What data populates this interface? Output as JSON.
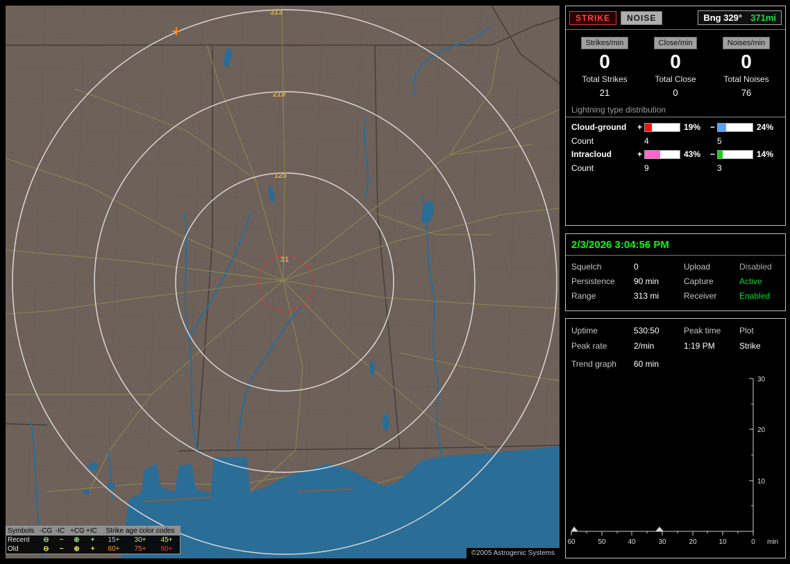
{
  "map": {
    "ring_labels": [
      "313",
      "219",
      "125",
      "31"
    ],
    "ring_label_color": "#d9b25f",
    "copyright": "©2005 Astrogenic Systems",
    "legend": {
      "symbols_header": "Symbols",
      "symbol_types": [
        "-CG",
        "-IC",
        "+CG",
        "+IC"
      ],
      "age_header": "Strike age color codes",
      "symbols": [
        "⊖",
        "−",
        "⊕",
        "+"
      ],
      "rows": [
        {
          "label": "Recent",
          "symbol_color": "#8ee08e",
          "ages": [
            {
              "text": "15+",
              "color": "#b9c8f2"
            },
            {
              "text": "30+",
              "color": "#dede9a"
            },
            {
              "text": "45+",
              "color": "#f0f060"
            }
          ]
        },
        {
          "label": "Old",
          "symbol_color": "#e8e860",
          "ages": [
            {
              "text": "60+",
              "color": "#ffa030"
            },
            {
              "text": "75+",
              "color": "#ff7030"
            },
            {
              "text": "90+",
              "color": "#ff3030"
            }
          ]
        }
      ]
    }
  },
  "sidebar": {
    "buttons": {
      "strike": "STRIKE",
      "noise": "NOISE"
    },
    "bearing": {
      "label": "Bng 329°",
      "range": "371mi",
      "range_color": "#00e645"
    },
    "counters": [
      {
        "label": "Strikes/min",
        "value": "0"
      },
      {
        "label": "Close/min",
        "value": "0"
      },
      {
        "label": "Noises/min",
        "value": "0"
      }
    ],
    "totals": [
      {
        "label": "Total Strikes",
        "value": "21"
      },
      {
        "label": "Total Close",
        "value": "0"
      },
      {
        "label": "Total Noises",
        "value": "76"
      }
    ],
    "distribution": {
      "title": "Lightning type distribution",
      "rows": [
        {
          "label": "Cloud-ground",
          "plus_sign": "+",
          "minus_sign": "−",
          "plus_pct": "19%",
          "plus_color": "#ff1010",
          "minus_pct": "24%",
          "minus_color": "#5aa0ff",
          "count_label": "Count",
          "plus_count": "4",
          "minus_count": "5"
        },
        {
          "label": "Intracloud",
          "plus_sign": "+",
          "minus_sign": "−",
          "plus_pct": "43%",
          "plus_color": "#ff66cc",
          "minus_pct": "14%",
          "minus_color": "#18d018",
          "count_label": "Count",
          "plus_count": "9",
          "minus_count": "3"
        }
      ]
    },
    "status": {
      "datetime": "2/3/2026 3:04:56 PM",
      "rows": [
        {
          "l1": "Squelch",
          "v1": "0",
          "l2": "Upload",
          "v2": "Disabled",
          "v2_color": "#aaaaaa"
        },
        {
          "l1": "Persistence",
          "v1": "90 min",
          "l2": "Capture",
          "v2": "Active",
          "v2_color": "#00dd33"
        },
        {
          "l1": "Range",
          "v1": "313 mi",
          "l2": "Receiver",
          "v2": "Enabled",
          "v2_color": "#00dd33"
        }
      ]
    },
    "info": {
      "uptime_label": "Uptime",
      "uptime": "530:50",
      "peak_time_label": "Peak time",
      "plot_label": "Plot",
      "peak_rate_label": "Peak rate",
      "peak_rate": "2/min",
      "peak_time": "1:19 PM",
      "plot_value": "Strike",
      "trend_label": "Trend graph",
      "trend_window": "60 min"
    }
  },
  "chart_data": {
    "type": "line",
    "title": "Trend graph",
    "window_label": "60 min",
    "x_ticks": [
      "60",
      "50",
      "40",
      "30",
      "20",
      "10",
      "0"
    ],
    "x_unit": "min",
    "y_ticks": [
      "30",
      "20",
      "10"
    ],
    "ylim": [
      0,
      30
    ],
    "series": [
      {
        "name": "Strike",
        "points": [
          {
            "minutes_ago": 59,
            "value": 1
          },
          {
            "minutes_ago": 31,
            "value": 1
          }
        ]
      }
    ]
  }
}
